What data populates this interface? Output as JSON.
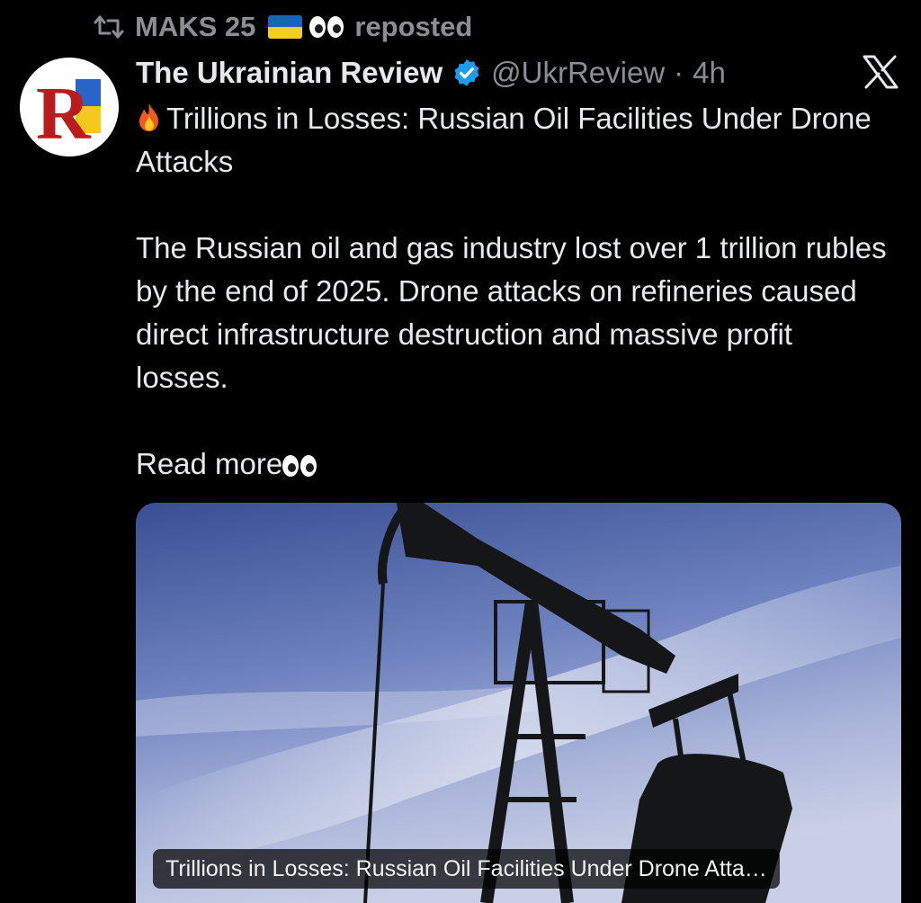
{
  "repost": {
    "user": "MAKS 25",
    "action": "reposted",
    "icon": "repost-icon"
  },
  "tweet": {
    "author_name": "The Ukrainian Review",
    "handle": "@UkrReview",
    "separator": "·",
    "time": "4h",
    "verified": true,
    "avatar_letter": "R",
    "headline": "Trillions in Losses: Russian Oil Facilities Under Drone Attacks",
    "body": "The Russian oil and gas industry lost over 1 trillion rubles by the end of 2025. Drone attacks on refineries caused direct infrastructure destruction and massive profit losses.",
    "read_more": "Read more"
  },
  "media": {
    "caption": "Trillions in Losses: Russian Oil Facilities Under Drone Atta…"
  },
  "colors": {
    "background": "#000000",
    "text": "#e7e9ea",
    "muted": "#8b8f93",
    "verified": "#1d9bf0"
  }
}
